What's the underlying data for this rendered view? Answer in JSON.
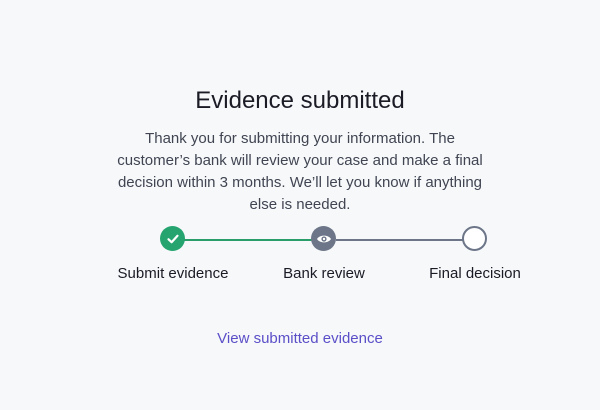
{
  "header": {
    "title": "Evidence submitted",
    "description": "Thank you for submitting your information. The customer’s bank will review your case and make a final decision within 3 months. We’ll let you know if anything else is needed."
  },
  "progress": {
    "steps": [
      {
        "label": "Submit evidence",
        "state": "complete",
        "icon": "check-icon"
      },
      {
        "label": "Bank review",
        "state": "current",
        "icon": "eye-icon"
      },
      {
        "label": "Final decision",
        "state": "upcoming",
        "icon": "empty-circle"
      }
    ],
    "colors": {
      "complete": "#25a46f",
      "current": "#6c7688",
      "upcoming_border": "#6c7688"
    }
  },
  "actions": {
    "view_evidence_label": "View submitted evidence",
    "link_color": "#5b4fc8"
  }
}
